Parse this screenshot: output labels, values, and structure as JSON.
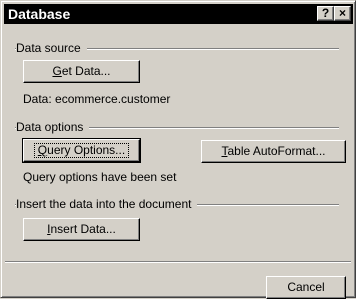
{
  "window": {
    "title": "Database",
    "help_icon": "?",
    "close_icon": "×"
  },
  "data_source": {
    "group_label": "Data source",
    "get_data_prefix": "G",
    "get_data_rest": "et Data...",
    "status_text": "Data: ecommerce.customer"
  },
  "data_options": {
    "group_label": "Data options",
    "query_options_prefix": "Q",
    "query_options_rest": "uery Options...",
    "table_autoformat_prefix": "T",
    "table_autoformat_rest": "able AutoFormat...",
    "status_text": "Query options have been set"
  },
  "insert": {
    "group_label": "Insert the data into the document",
    "insert_data_prefix": "I",
    "insert_data_rest": "nsert Data..."
  },
  "footer": {
    "cancel_label": "Cancel"
  }
}
